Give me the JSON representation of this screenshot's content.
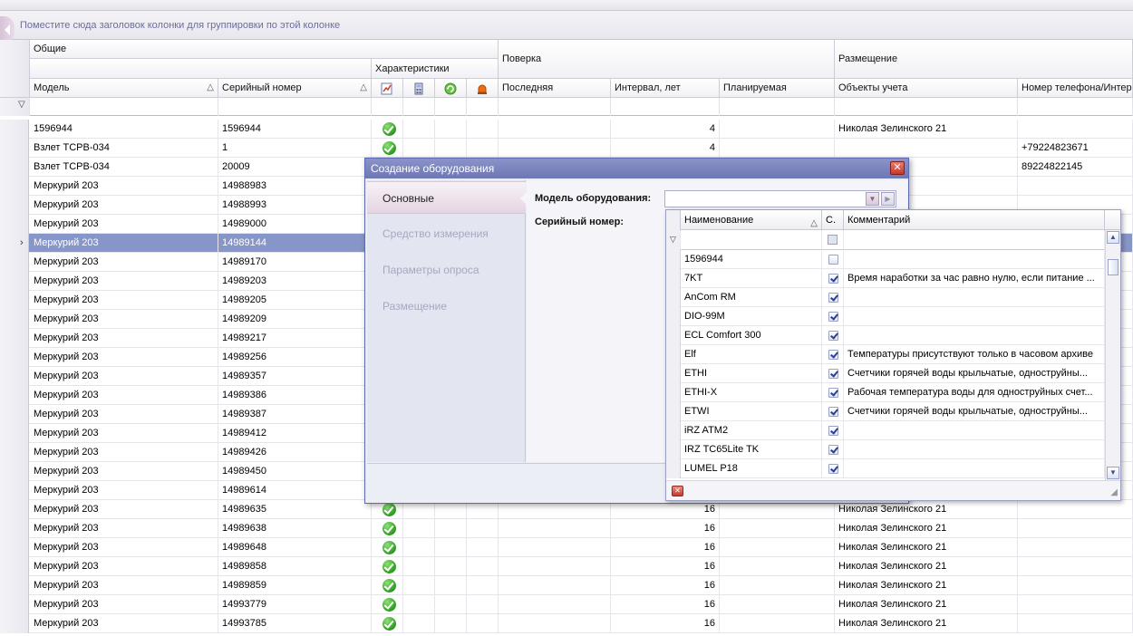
{
  "group_panel": {
    "hint": "Поместите сюда заголовок колонки для группировки по этой колонке"
  },
  "header": {
    "band_general": "Общие",
    "band_characteristics": "Характеристики",
    "band_verification": "Поверка",
    "band_placement": "Размещение",
    "col_model": "Модель",
    "col_serial": "Серийный номер",
    "col_last": "Последняя",
    "col_interval": "Интервал, лет",
    "col_planned": "Планируемая",
    "col_objects": "Объекты учета",
    "col_phone": "Номер телефона/Интер."
  },
  "rows": [
    {
      "model": "1596944",
      "serial": "1596944",
      "ok": true,
      "interval": "4",
      "object": "Николая Зелинского 21",
      "phone": ""
    },
    {
      "model": "Взлет ТСРВ-034",
      "serial": "1",
      "ok": true,
      "interval": "4",
      "object": "",
      "phone": "+79224823671"
    },
    {
      "model": "Взлет ТСРВ-034",
      "serial": "20009",
      "ok": false,
      "interval": "",
      "object": "",
      "phone": "89224822145"
    },
    {
      "model": "Меркурий 203",
      "serial": "14988983",
      "ok": false,
      "interval": "",
      "object": "ого 21",
      "phone": ""
    },
    {
      "model": "Меркурий 203",
      "serial": "14988993",
      "ok": false,
      "interval": "",
      "object": "ого 21",
      "phone": ""
    },
    {
      "model": "Меркурий 203",
      "serial": "14989000",
      "ok": false,
      "interval": "",
      "object": "",
      "phone": ""
    },
    {
      "model": "Меркурий 203",
      "serial": "14989144",
      "ok": false,
      "interval": "",
      "object": "",
      "phone": "",
      "selected": true
    },
    {
      "model": "Меркурий 203",
      "serial": "14989170",
      "ok": false,
      "interval": "",
      "object": "",
      "phone": ""
    },
    {
      "model": "Меркурий 203",
      "serial": "14989203",
      "ok": false,
      "interval": "",
      "object": "",
      "phone": ""
    },
    {
      "model": "Меркурий 203",
      "serial": "14989205",
      "ok": false,
      "interval": "",
      "object": "",
      "phone": ""
    },
    {
      "model": "Меркурий 203",
      "serial": "14989209",
      "ok": false,
      "interval": "",
      "object": "",
      "phone": ""
    },
    {
      "model": "Меркурий 203",
      "serial": "14989217",
      "ok": false,
      "interval": "",
      "object": "",
      "phone": ""
    },
    {
      "model": "Меркурий 203",
      "serial": "14989256",
      "ok": false,
      "interval": "",
      "object": "",
      "phone": ""
    },
    {
      "model": "Меркурий 203",
      "serial": "14989357",
      "ok": false,
      "interval": "",
      "object": "",
      "phone": ""
    },
    {
      "model": "Меркурий 203",
      "serial": "14989386",
      "ok": false,
      "interval": "",
      "object": "",
      "phone": ""
    },
    {
      "model": "Меркурий 203",
      "serial": "14989387",
      "ok": false,
      "interval": "",
      "object": "",
      "phone": ""
    },
    {
      "model": "Меркурий 203",
      "serial": "14989412",
      "ok": false,
      "interval": "",
      "object": "",
      "phone": ""
    },
    {
      "model": "Меркурий 203",
      "serial": "14989426",
      "ok": false,
      "interval": "",
      "object": "",
      "phone": ""
    },
    {
      "model": "Меркурий 203",
      "serial": "14989450",
      "ok": false,
      "interval": "",
      "object": "",
      "phone": ""
    },
    {
      "model": "Меркурий 203",
      "serial": "14989614",
      "ok": false,
      "interval": "",
      "object": "",
      "phone": ""
    },
    {
      "model": "Меркурий 203",
      "serial": "14989635",
      "ok": true,
      "interval": "16",
      "object": "Николая Зелинского 21",
      "phone": ""
    },
    {
      "model": "Меркурий 203",
      "serial": "14989638",
      "ok": true,
      "interval": "16",
      "object": "Николая Зелинского 21",
      "phone": ""
    },
    {
      "model": "Меркурий 203",
      "serial": "14989648",
      "ok": true,
      "interval": "16",
      "object": "Николая Зелинского 21",
      "phone": ""
    },
    {
      "model": "Меркурий 203",
      "serial": "14989858",
      "ok": true,
      "interval": "16",
      "object": "Николая Зелинского 21",
      "phone": ""
    },
    {
      "model": "Меркурий 203",
      "serial": "14989859",
      "ok": true,
      "interval": "16",
      "object": "Николая Зелинского 21",
      "phone": ""
    },
    {
      "model": "Меркурий 203",
      "serial": "14993779",
      "ok": true,
      "interval": "16",
      "object": "Николая Зелинского 21",
      "phone": ""
    },
    {
      "model": "Меркурий 203",
      "serial": "14993785",
      "ok": true,
      "interval": "16",
      "object": "Николая Зелинского 21",
      "phone": ""
    }
  ],
  "dialog": {
    "title": "Создание оборудования",
    "close": "✕",
    "nav": [
      "Основные",
      "Средство измерения",
      "Параметры опроса",
      "Размещение"
    ],
    "model_label": "Модель оборудования:",
    "serial_label": "Серийный номер:",
    "model_value": ""
  },
  "dropdown": {
    "col_name": "Наименование",
    "col_c": "С.",
    "col_comment": "Комментарий",
    "items": [
      {
        "name": "1596944",
        "checked": false,
        "comment": ""
      },
      {
        "name": "7KT",
        "checked": true,
        "comment": "Время наработки за час равно нулю, если питание ..."
      },
      {
        "name": "AnCom RM",
        "checked": true,
        "comment": ""
      },
      {
        "name": "DIO-99M",
        "checked": true,
        "comment": ""
      },
      {
        "name": "ECL Comfort 300",
        "checked": true,
        "comment": ""
      },
      {
        "name": "Elf",
        "checked": true,
        "comment": "Температуры присутствуют только в часовом архиве"
      },
      {
        "name": "ETHI",
        "checked": true,
        "comment": "Счетчики горячей воды крыльчатые, одноструйны..."
      },
      {
        "name": "ETHI-X",
        "checked": true,
        "comment": "Рабочая температура воды для одноструйных счет..."
      },
      {
        "name": "ETWI",
        "checked": true,
        "comment": "Счетчики горячей воды крыльчатые, одноструйны..."
      },
      {
        "name": "iRZ ATM2",
        "checked": true,
        "comment": ""
      },
      {
        "name": "IRZ TC65Lite TK",
        "checked": true,
        "comment": ""
      },
      {
        "name": "LUMEL P18",
        "checked": true,
        "comment": ""
      }
    ]
  },
  "icons": {
    "ok": "check-circle-icon",
    "sort": "sort-ascending-icon",
    "filter": "filter-icon"
  },
  "colors": {
    "selected_row": "#8796c8",
    "dialog_title": "#6d77b4",
    "ok_green": "#2c9a1e"
  }
}
